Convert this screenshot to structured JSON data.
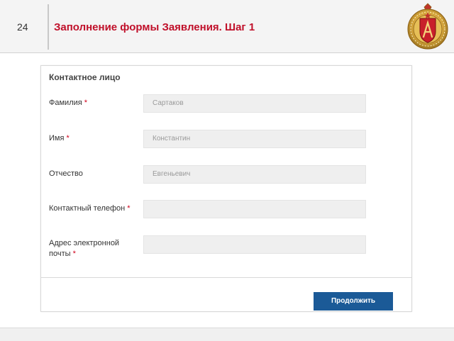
{
  "header": {
    "page_number": "24",
    "title": "Заполнение формы Заявления. Шаг 1",
    "emblem_icon": "military-academy-emblem-icon"
  },
  "form": {
    "section_title": "Контактное лицо",
    "required_marker": "*",
    "fields": [
      {
        "label": "Фамилия",
        "required": true,
        "value": "Сартаков"
      },
      {
        "label": "Имя",
        "required": true,
        "value": "Константин"
      },
      {
        "label": "Отчество",
        "required": false,
        "value": "Евгеньевич"
      },
      {
        "label": "Контактный телефон",
        "required": true,
        "value": ""
      },
      {
        "label": "Адрес электронной почты",
        "required": true,
        "value": ""
      }
    ],
    "continue_label": "Продолжить"
  },
  "colors": {
    "title": "#c0102a",
    "required": "#d0021b",
    "button": "#1b5a97",
    "input_bg": "#efefef"
  }
}
